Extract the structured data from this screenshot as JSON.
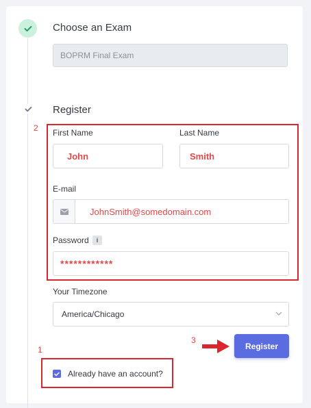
{
  "steps": {
    "exam": {
      "title": "Choose an Exam",
      "selected": "BOPRM Final Exam"
    },
    "register": {
      "title": "Register"
    }
  },
  "form": {
    "first_name": {
      "label": "First Name",
      "value": "John"
    },
    "last_name": {
      "label": "Last Name",
      "value": "Smith"
    },
    "email": {
      "label": "E-mail",
      "value": "JohnSmith@somedomain.com"
    },
    "password": {
      "label": "Password",
      "value": "************",
      "info": "i"
    },
    "timezone": {
      "label": "Your Timezone",
      "value": "America/Chicago"
    },
    "register_button": "Register",
    "already_account": "Already have an account?"
  },
  "annotations": {
    "one": "1",
    "two": "2",
    "three": "3"
  },
  "colors": {
    "accent": "#5b6be0",
    "success_badge": "#c9f1de",
    "success_check": "#2f9a6a",
    "annotation_red": "#d9262f"
  }
}
